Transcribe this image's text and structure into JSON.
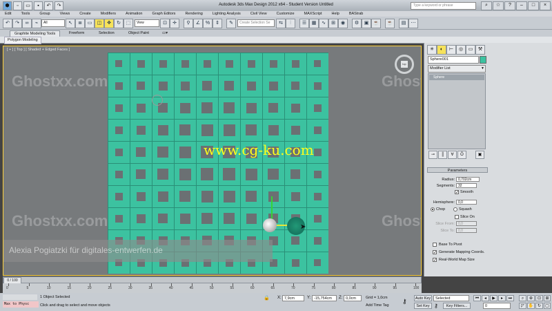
{
  "titlebar": {
    "title": "Autodesk 3ds Max Design 2012 x64 - Student Version    Untitled",
    "search_placeholder": "Type a keyword or phrase"
  },
  "menu": [
    "Edit",
    "Tools",
    "Group",
    "Views",
    "Create",
    "Modifiers",
    "Animation",
    "Graph Editors",
    "Rendering",
    "Lighting Analysis",
    "Civil View",
    "Customize",
    "MAXScript",
    "Help",
    "BAStrab"
  ],
  "toolbar": {
    "selection_filter": "All",
    "coord_system": "View",
    "selection_set_placeholder": "Create Selection Se"
  },
  "ribbon": {
    "tabs": [
      "Graphite Modeling Tools",
      "Freeform",
      "Selection",
      "Object Paint"
    ],
    "sub_label": "Polygon Modeling"
  },
  "viewport": {
    "label": "[ + ] [ Top ] [ Shaded + Edged Faces ]",
    "viewcube_label": "top"
  },
  "overlay": {
    "watermark": "www.cg-ku.com",
    "ghost_text": "Ghostxx.com",
    "credit": "Alexia Pogiatzki  für digitales-entwerfen.de"
  },
  "command_panel": {
    "object_name": "Sphere001",
    "modifier_list": "Modifier List",
    "stack_item": "Sphere",
    "parameters": {
      "header": "Parameters",
      "radius_label": "Radius:",
      "radius": "0,702cm",
      "segments_label": "Segments:",
      "segments": "32",
      "smooth": "Smooth",
      "hemisphere_label": "Hemisphere:",
      "hemisphere": "0,0",
      "chop": "Chop",
      "squash": "Squash",
      "slice_on": "Slice On",
      "slice_from_label": "Slice From:",
      "slice_from": "0,0",
      "slice_to_label": "Slice To:",
      "slice_to": "0,0",
      "base_to_pivot": "Base To Pivot",
      "gen_mapping": "Generate Mapping Coords.",
      "real_world": "Real-World Map Size"
    }
  },
  "timeline": {
    "frame_display": "0 / 100",
    "ticks": [
      "0",
      "5",
      "10",
      "15",
      "20",
      "25",
      "30",
      "35",
      "40",
      "45",
      "50",
      "55",
      "60",
      "65",
      "70",
      "75",
      "80",
      "85",
      "90",
      "95",
      "100"
    ]
  },
  "status": {
    "maxscript": "Max to Physc",
    "selection": "1 Object Selected",
    "prompt": "Click and drag to select and move objects",
    "x_label": "X:",
    "x": "7,9cm",
    "y_label": "Y:",
    "y": "-15,754cm",
    "z_label": "Z:",
    "z": "0,0cm",
    "grid": "Grid = 1,0cm",
    "add_time_tag": "Add Time Tag",
    "auto_key": "Auto Key",
    "selected": "Selected",
    "set_key": "Set Key",
    "key_filters": "Key Filters...",
    "frame": "0"
  }
}
